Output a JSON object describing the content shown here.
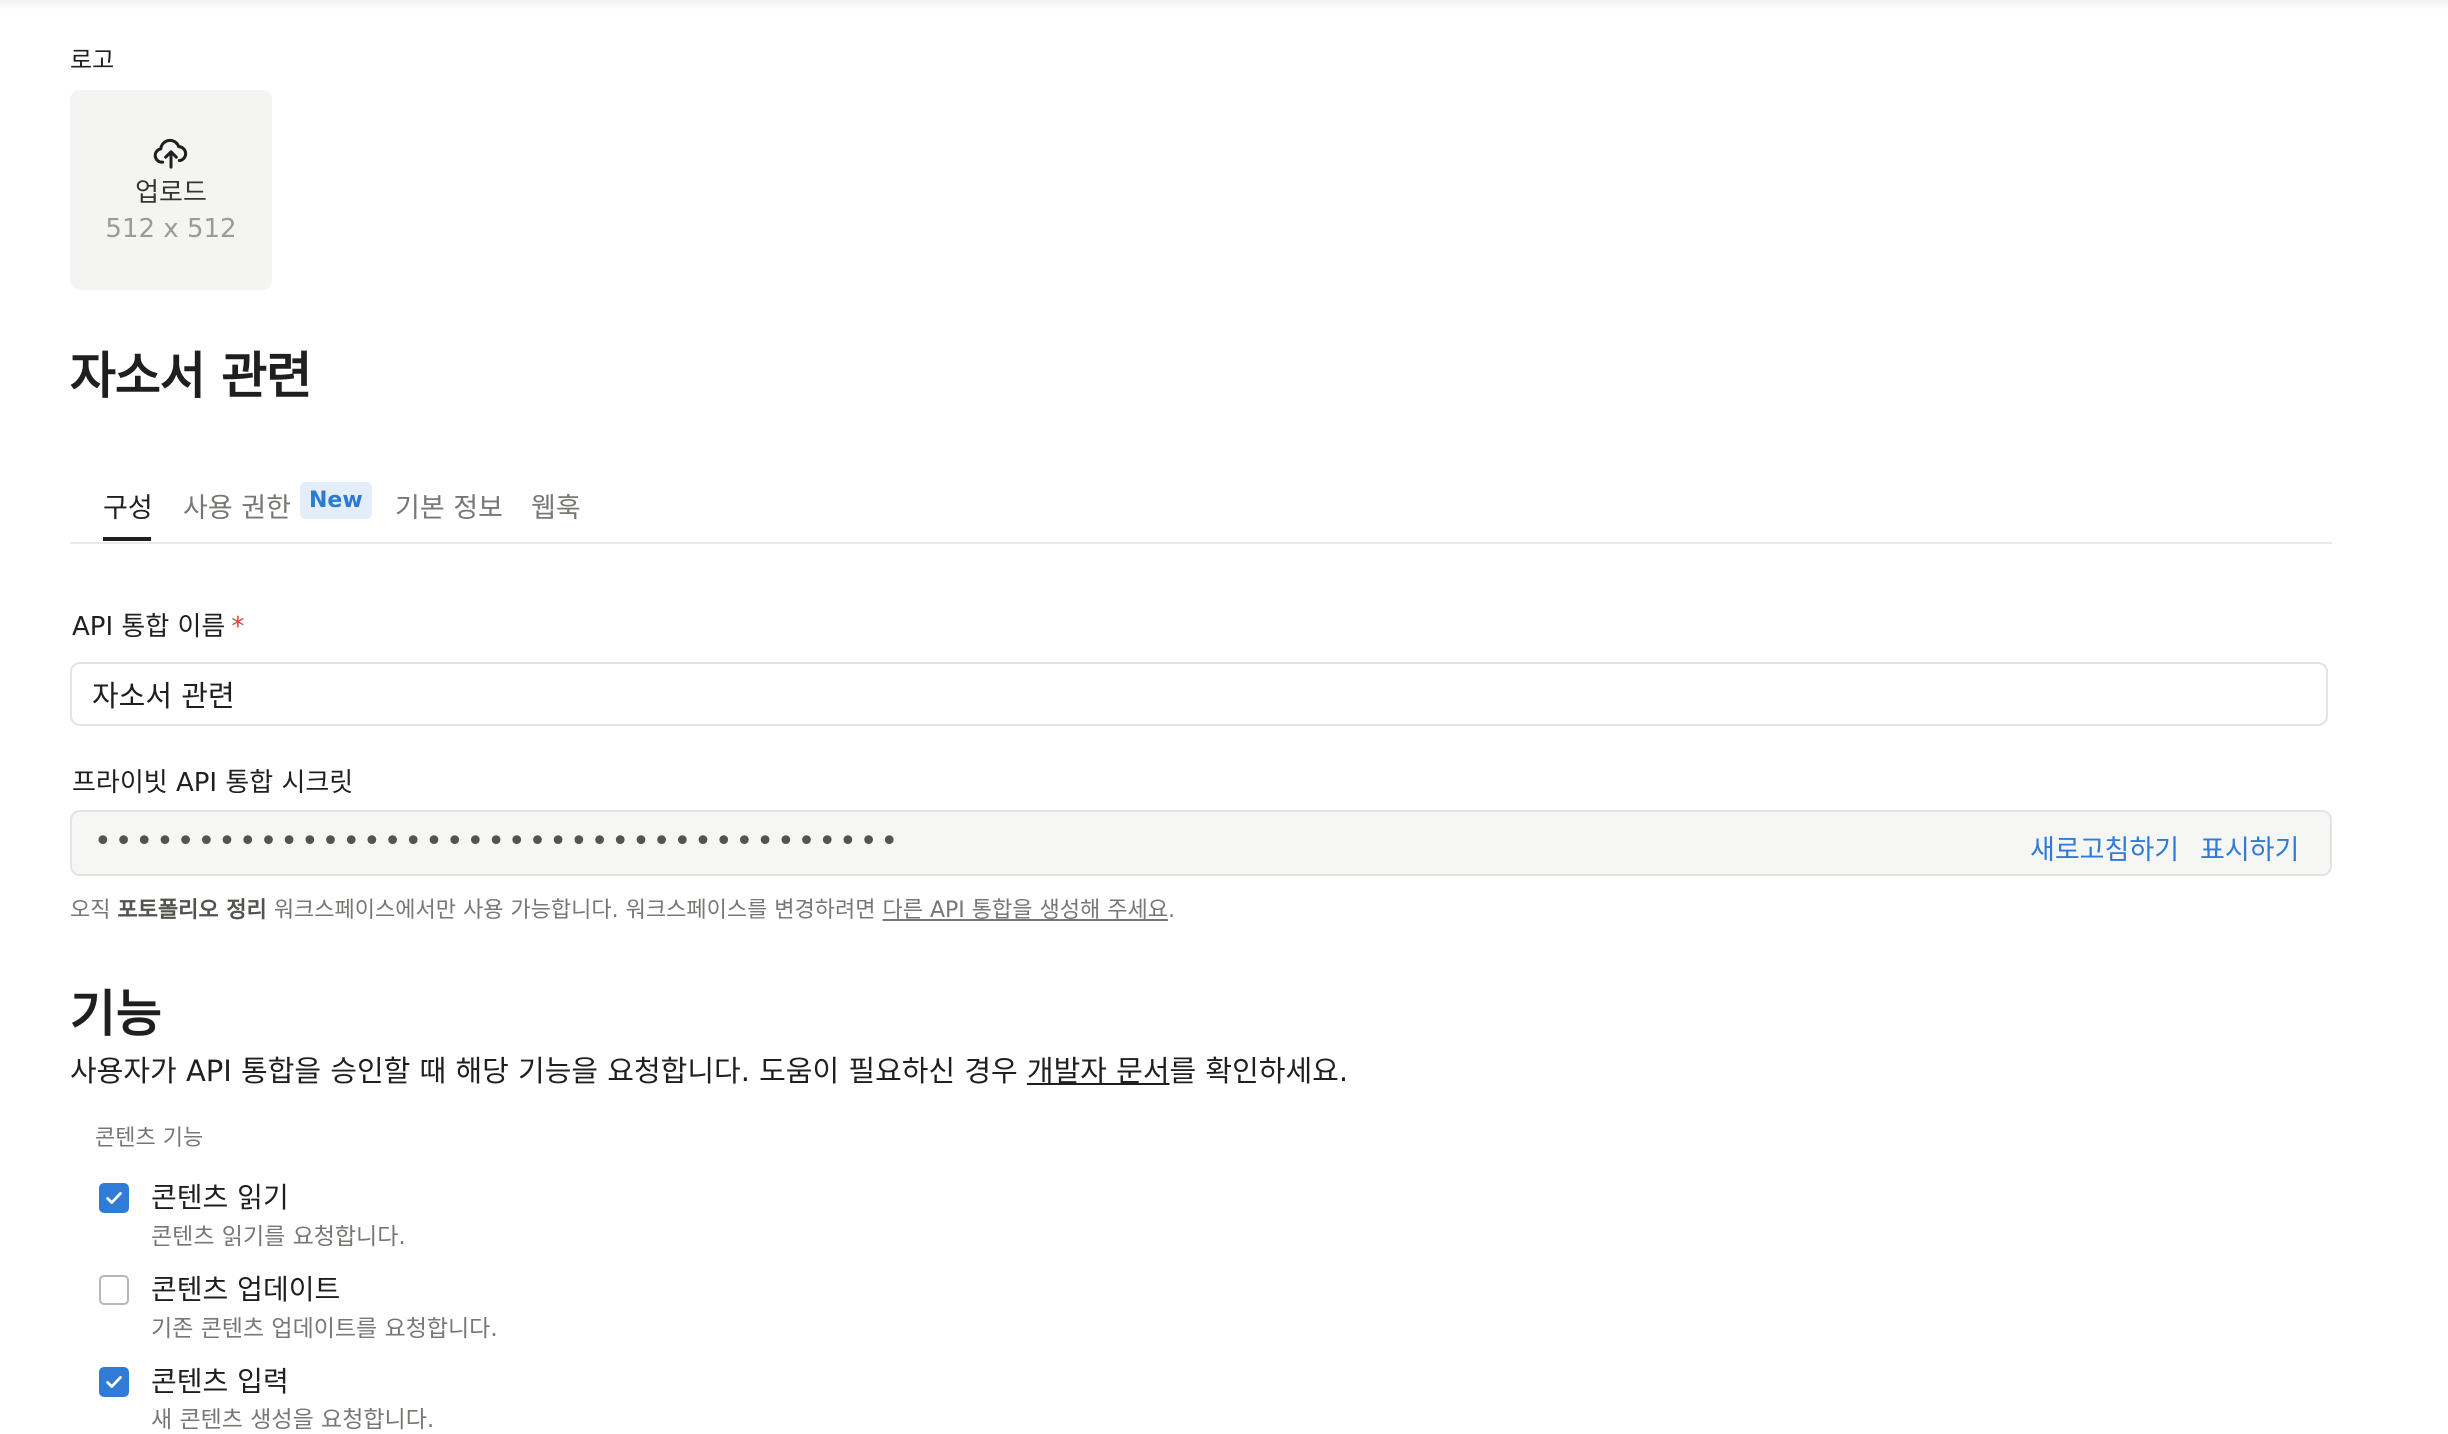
{
  "logo": {
    "label": "로고",
    "upload_label": "업로드",
    "upload_size": "512 x 512",
    "icon": "cloud-upload-icon"
  },
  "page_title": "자소서 관련",
  "tabs": [
    {
      "label": "구성",
      "active": true
    },
    {
      "label": "사용 권한",
      "badge": "New",
      "active": false
    },
    {
      "label": "기본 정보",
      "active": false
    },
    {
      "label": "웹훅",
      "active": false
    }
  ],
  "form": {
    "name_label": "API 통합 이름",
    "required_mark": "*",
    "name_value": "자소서 관련",
    "secret_label": "프라이빗 API 통합 시크릿",
    "secret_masked": "•••••••••••••••••••••••••••••••••••••••",
    "refresh_label": "새로고침하기",
    "show_label": "표시하기",
    "hint_prefix": "오직 ",
    "hint_workspace": "포토폴리오 정리",
    "hint_middle": " 워크스페이스에서만 사용 가능합니다. 워크스페이스를 변경하려면 ",
    "hint_link": "다른 API 통합을 생성해 주세요",
    "hint_suffix": "."
  },
  "capabilities": {
    "title": "기능",
    "desc_prefix": "사용자가 API 통합을 승인할 때 해당 기능을 요청합니다. 도움이 필요하신 경우 ",
    "desc_link": "개발자 문서",
    "desc_suffix": "를 확인하세요.",
    "group_label": "콘텐츠 기능",
    "options": [
      {
        "title": "콘텐츠 읽기",
        "desc": "콘텐츠 읽기를 요청합니다.",
        "checked": true
      },
      {
        "title": "콘텐츠 업데이트",
        "desc": "기존 콘텐츠 업데이트를 요청합니다.",
        "checked": false
      },
      {
        "title": "콘텐츠 입력",
        "desc": "새 콘텐츠 생성을 요청합니다.",
        "checked": true
      }
    ]
  },
  "colors": {
    "accent": "#2f7bd6",
    "required": "#e03e3e",
    "badge_bg": "#e3eefa"
  }
}
